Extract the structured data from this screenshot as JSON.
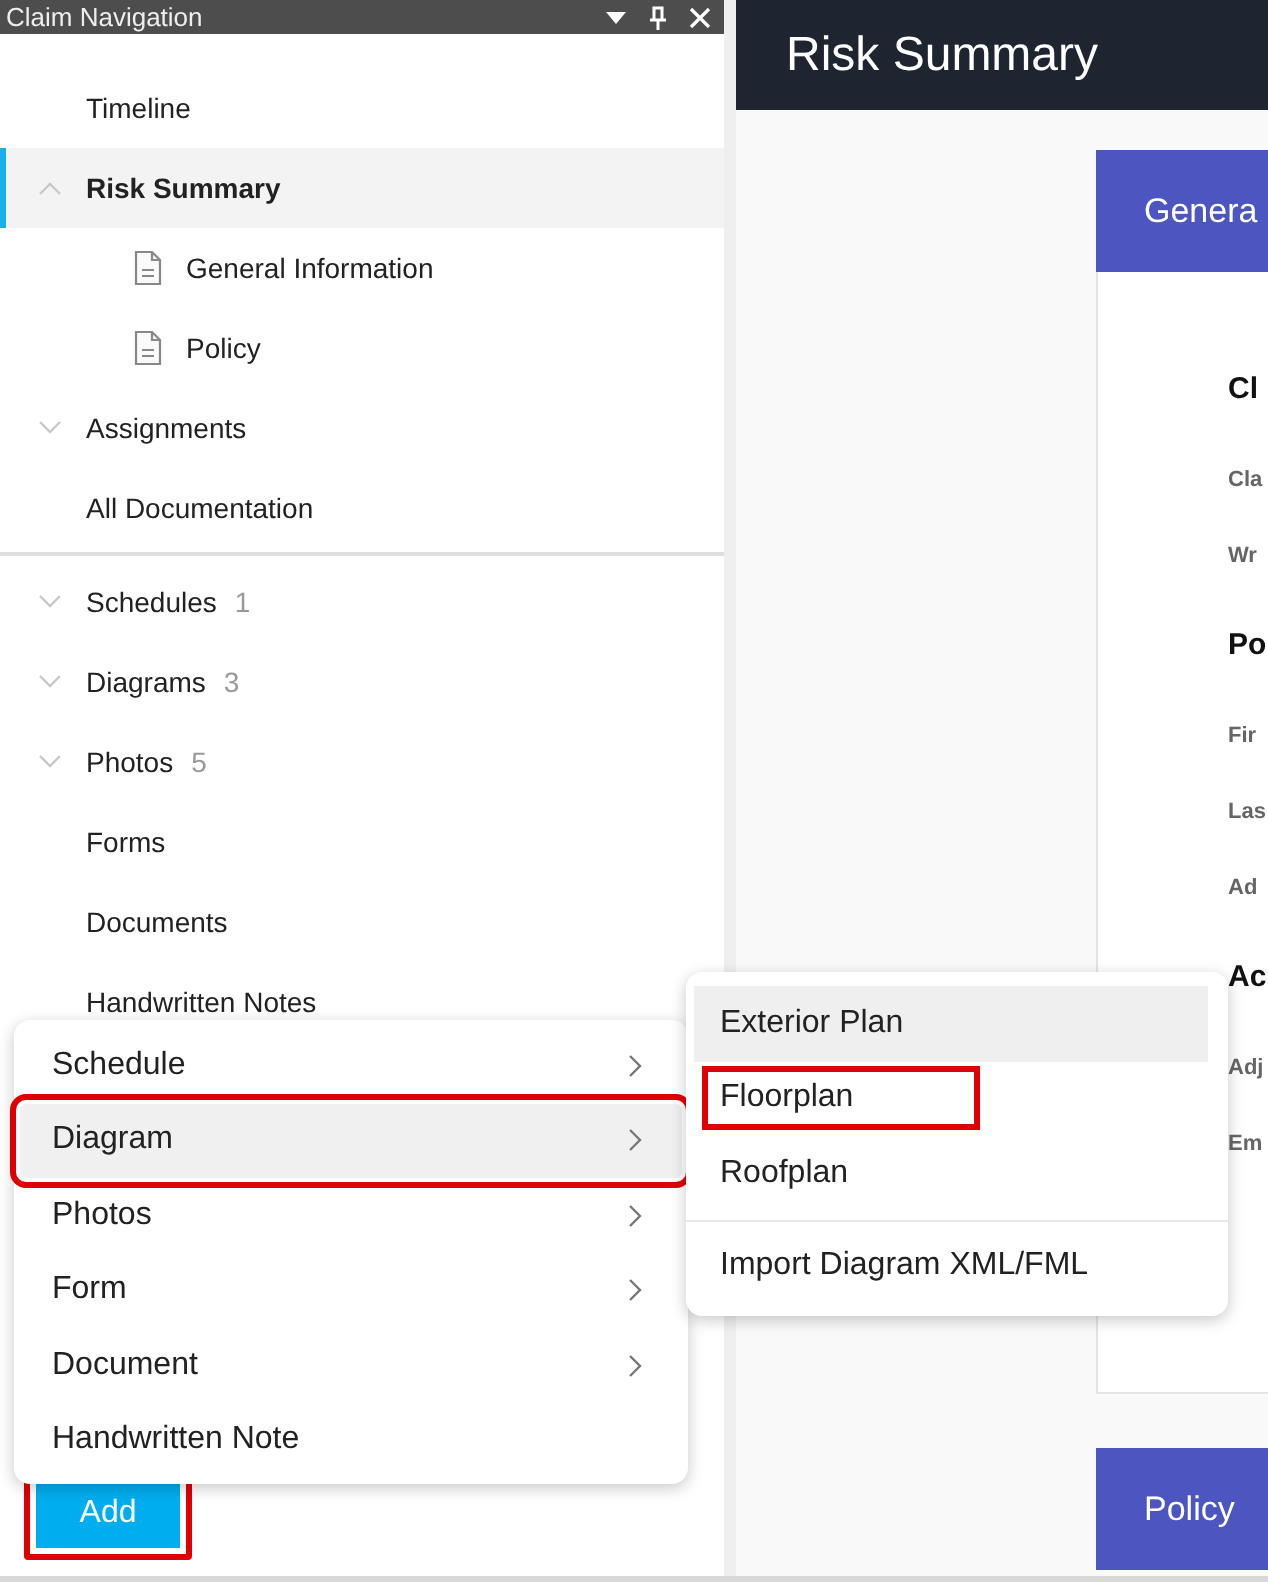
{
  "panel": {
    "title": "Claim Navigation"
  },
  "tree_groups": [
    [
      {
        "label": "Timeline",
        "selected": false
      },
      {
        "label": "Risk Summary",
        "selected": true,
        "expanded": true,
        "children": [
          {
            "label": "General Information"
          },
          {
            "label": "Policy"
          }
        ]
      },
      {
        "label": "Assignments",
        "selected": false,
        "expanded": false
      },
      {
        "label": "All Documentation",
        "selected": false
      }
    ],
    [
      {
        "label": "Schedules",
        "count": "1",
        "selected": false,
        "expanded": false
      },
      {
        "label": "Diagrams",
        "count": "3",
        "selected": false,
        "expanded": false
      },
      {
        "label": "Photos",
        "count": "5",
        "selected": false,
        "expanded": false
      },
      {
        "label": "Forms",
        "selected": false
      },
      {
        "label": "Documents",
        "selected": false
      },
      {
        "label": "Handwritten Notes",
        "selected": false
      }
    ]
  ],
  "add_menu": [
    {
      "label": "Schedule",
      "submenu": true,
      "selected": false,
      "highlighted": false
    },
    {
      "label": "Diagram",
      "submenu": true,
      "selected": true,
      "highlighted": true
    },
    {
      "label": "Photos",
      "submenu": true,
      "selected": false,
      "highlighted": false
    },
    {
      "label": "Form",
      "submenu": true,
      "selected": false,
      "highlighted": false
    },
    {
      "label": "Document",
      "submenu": true,
      "selected": false,
      "highlighted": false
    },
    {
      "label": "Handwritten Note",
      "submenu": false,
      "selected": false,
      "highlighted": false
    }
  ],
  "diagram_submenu": [
    [
      {
        "label": "Exterior Plan",
        "selected": true,
        "highlighted": false
      },
      {
        "label": "Floorplan",
        "selected": false,
        "highlighted": true
      },
      {
        "label": "Roofplan",
        "selected": false,
        "highlighted": false
      }
    ],
    [
      {
        "label": "Import Diagram XML/FML",
        "selected": false,
        "highlighted": false
      }
    ]
  ],
  "add_button": {
    "label": "Add",
    "highlighted": true
  },
  "page": {
    "title": "Risk Summary",
    "tab": "Genera",
    "card_rows": [
      {
        "kind": "heading",
        "text": "Cl"
      },
      {
        "kind": "label",
        "text": "Cla"
      },
      {
        "kind": "label",
        "text": "Wr"
      },
      {
        "kind": "heading",
        "text": "Po"
      },
      {
        "kind": "label",
        "text": "Fir"
      },
      {
        "kind": "label",
        "text": "Las"
      },
      {
        "kind": "label",
        "text": "Ad"
      },
      {
        "kind": "heading",
        "text": "Ac"
      },
      {
        "kind": "label",
        "text": "Adj"
      },
      {
        "kind": "label",
        "text": "Em"
      }
    ],
    "footer_tab": "Policy"
  }
}
